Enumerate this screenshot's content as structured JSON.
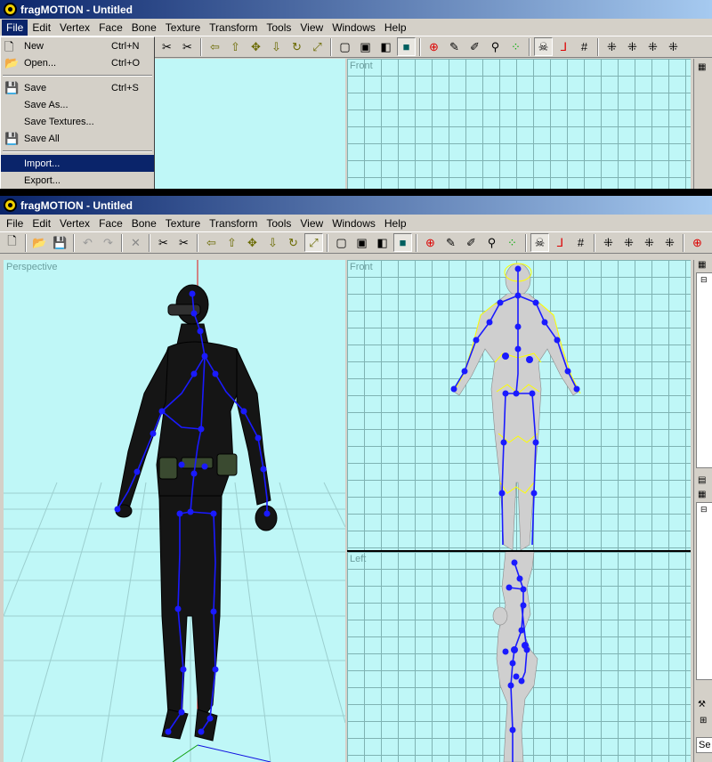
{
  "app": {
    "title": "fragMOTION - Untitled"
  },
  "menus": [
    "File",
    "Edit",
    "Vertex",
    "Face",
    "Bone",
    "Texture",
    "Transform",
    "Tools",
    "View",
    "Windows",
    "Help"
  ],
  "file_menu": {
    "items": [
      {
        "label": "New",
        "shortcut": "Ctrl+N",
        "icon": "new-file-icon"
      },
      {
        "label": "Open...",
        "shortcut": "Ctrl+O",
        "icon": "open-folder-icon"
      },
      {
        "label": "Save",
        "shortcut": "Ctrl+S",
        "icon": "save-disk-icon"
      },
      {
        "label": "Save As...",
        "shortcut": ""
      },
      {
        "label": "Save Textures...",
        "shortcut": ""
      },
      {
        "label": "Save All",
        "shortcut": "",
        "icon": "save-all-icon"
      },
      {
        "label": "Import...",
        "shortcut": "",
        "highlighted": true
      },
      {
        "label": "Export...",
        "shortcut": ""
      }
    ]
  },
  "viewports": {
    "perspective": "Perspective",
    "front": "Front",
    "left": "Left"
  },
  "side_panel": {
    "input_text": "Se"
  },
  "colors": {
    "viewport_bg": "#bff7f7",
    "grid": "#7fb3b3",
    "titlebar": "#0a246a",
    "skeleton": "#1a1aff",
    "wireframe": "#ffff00",
    "model_dark": "#151515",
    "model_gray": "#c8c8c8"
  }
}
